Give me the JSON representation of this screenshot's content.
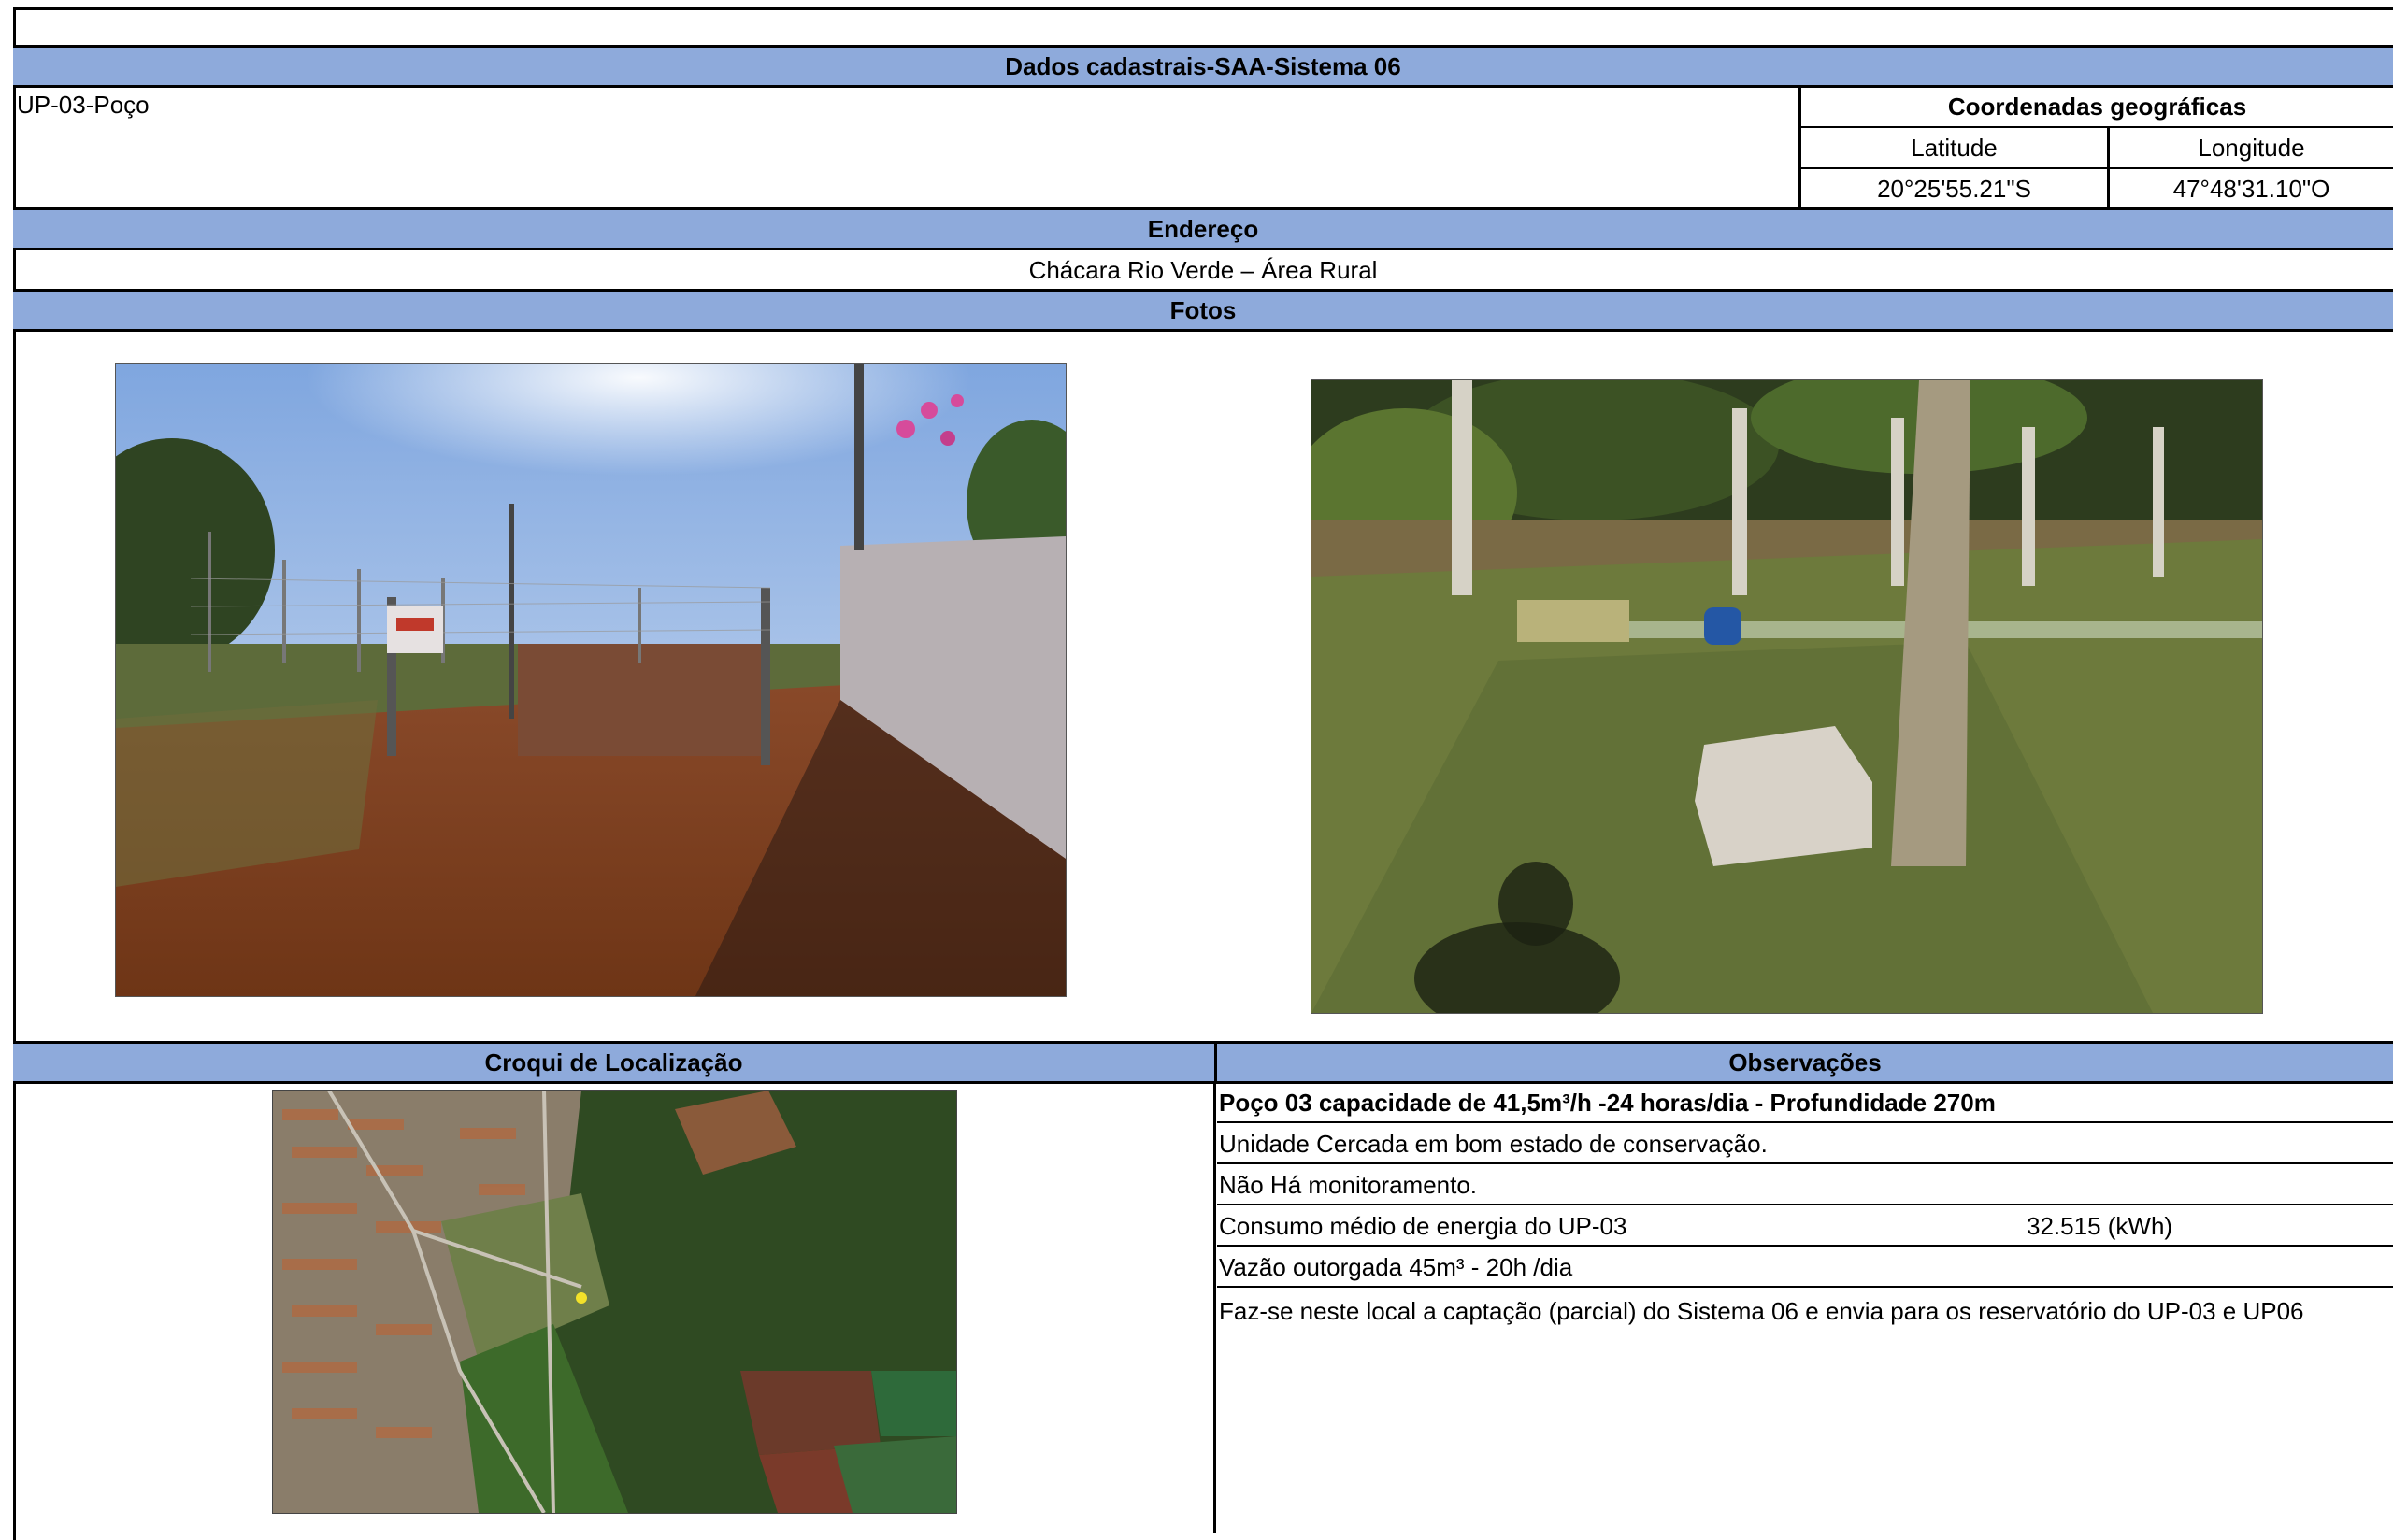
{
  "header": {
    "title": "Dados cadastrais-SAA-Sistema 06",
    "unit_name": "UP-03-Poço"
  },
  "coordinates": {
    "title": "Coordenadas geográficas",
    "lat_label": "Latitude",
    "lon_label": "Longitude",
    "lat_value": "20°25'55.21\"S",
    "lon_value": "47°48'31.10\"O"
  },
  "address": {
    "title": "Endereço",
    "value": "Chácara Rio Verde – Área Rural"
  },
  "photos": {
    "title": "Fotos"
  },
  "location": {
    "title": "Croqui de Localização"
  },
  "observations": {
    "title": "Observações",
    "rows": [
      "Poço 03 capacidade de 41,5m³/h -24 horas/dia - Profundidade 270m",
      "Unidade Cercada em bom estado de conservação.",
      "Não Há monitoramento.",
      "Consumo médio de energia do UP-03",
      "Vazão outorgada 45m³ - 20h /dia",
      "Faz-se neste local a captação (parcial) do Sistema 06 e envia para os reservatório do UP-03 e UP06"
    ],
    "energy_value": "32.515",
    "energy_unit": "(kWh)"
  },
  "colors": {
    "header_band": "#8eaadb",
    "border": "#000000"
  }
}
